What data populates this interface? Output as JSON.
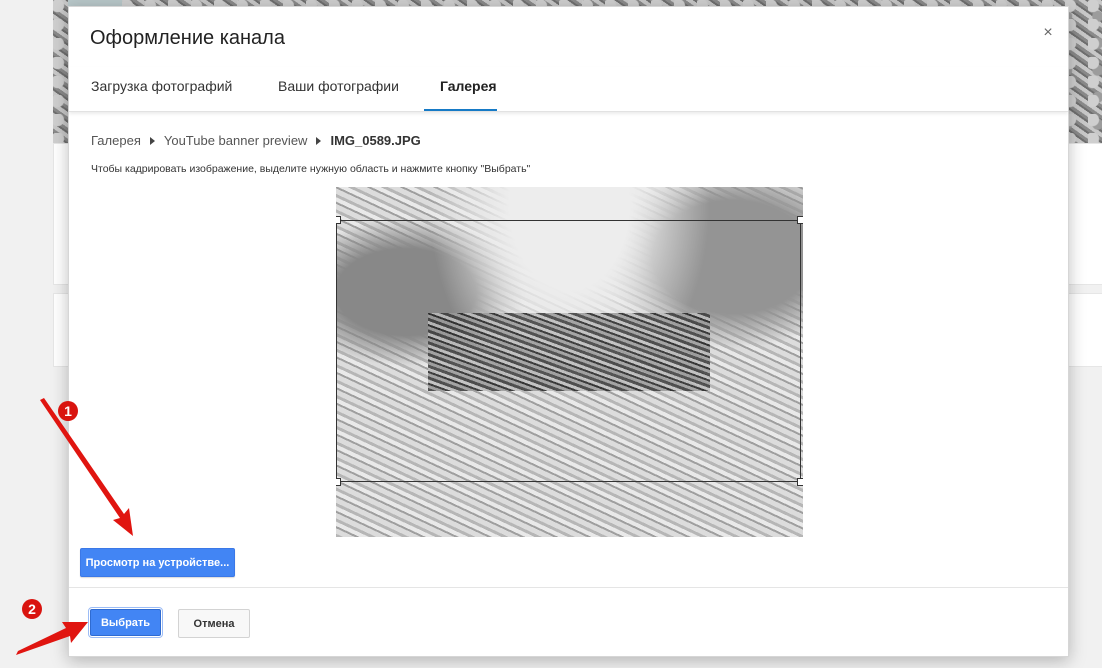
{
  "dialog": {
    "title": "Оформление канала",
    "close_glyph": "×",
    "tabs": [
      {
        "label": "Загрузка фотографий",
        "active": false
      },
      {
        "label": "Ваши фотографии",
        "active": false
      },
      {
        "label": "Галерея",
        "active": true
      }
    ],
    "breadcrumb": [
      "Галерея",
      "YouTube banner preview",
      "IMG_0589.JPG"
    ],
    "hint": "Чтобы кадрировать изображение, выделите нужную область и нажмите кнопку \"Выбрать\"",
    "preview_button": "Просмотр на устройстве...",
    "select_button": "Выбрать",
    "cancel_button": "Отмена"
  },
  "annotations": {
    "badge_1": "1",
    "badge_2": "2",
    "color": "#d9140f"
  },
  "colors": {
    "primary_button": "#4285f4",
    "tab_underline": "#167ac6"
  }
}
